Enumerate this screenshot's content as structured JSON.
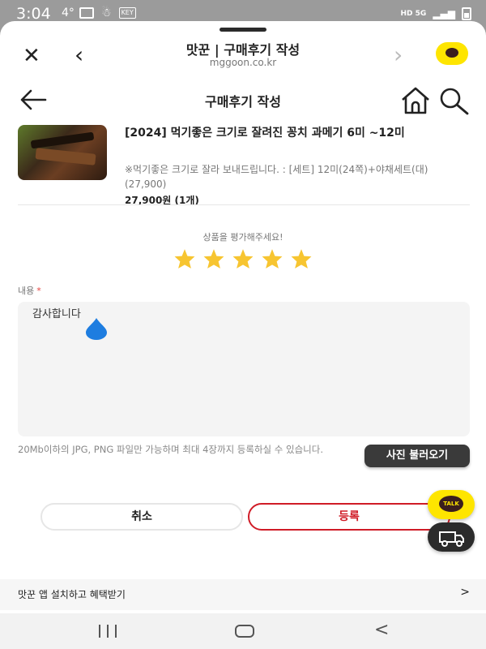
{
  "status_bar": {
    "time": "3:04",
    "temperature": "4°",
    "key_badge": "KEY",
    "network": "HD 5G"
  },
  "browser": {
    "title": "맛꾼 | 구매후기 작성",
    "url": "mggoon.co.kr",
    "close_icon": "close-icon",
    "back_icon": "chevron-left-icon",
    "forward_icon": "chevron-right-icon",
    "kakao_icon": "kakao-chat-icon"
  },
  "header": {
    "title": "구매후기 작성",
    "back_icon": "arrow-left-icon",
    "home_icon": "home-icon",
    "search_icon": "search-icon"
  },
  "product": {
    "name": "[2024] 먹기좋은 크기로 잘려진 꽁치 과메기 6미 ~12미",
    "option": "※먹기좋은 크기로 잘라 보내드립니다. : [세트] 12미(24쪽)+야채세트(대) (27,900)",
    "price": "27,900원 (1개)"
  },
  "rating": {
    "prompt": "상품을 평가해주세요!",
    "value": 5,
    "max": 5,
    "star_color": "#f7c531"
  },
  "review": {
    "label": "내용",
    "required_mark": "*",
    "text": "감사합니다"
  },
  "upload": {
    "note": "20Mb이하의 JPG, PNG 파일만 가능하며 최대 4장까지 등록하실 수 있습니다.",
    "button_label": "사진 불러오기"
  },
  "actions": {
    "cancel_label": "취소",
    "submit_label": "등록",
    "accent": "#d01c27"
  },
  "floating": {
    "talk_label": "TALK",
    "delivery_icon": "delivery-truck-icon"
  },
  "app_banner": {
    "text": "맛꾼 앱 설치하고 혜택받기",
    "arrow": ">"
  },
  "nav": {
    "recent_icon": "recent-apps-icon",
    "home_icon": "home-nav-icon",
    "back_label": "<"
  }
}
